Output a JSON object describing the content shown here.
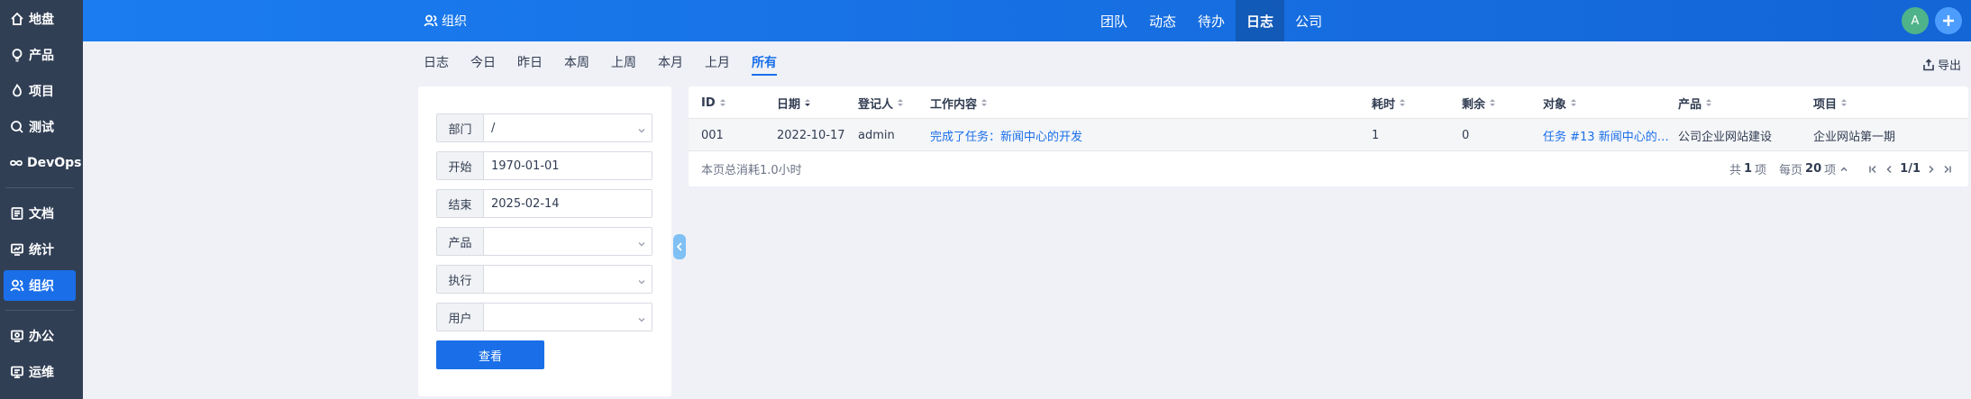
{
  "sidebar": {
    "items": [
      {
        "label": "地盘",
        "icon": "home-icon"
      },
      {
        "label": "产品",
        "icon": "lightbulb-icon"
      },
      {
        "label": "项目",
        "icon": "flame-icon"
      },
      {
        "label": "测试",
        "icon": "search-icon"
      },
      {
        "label": "DevOps",
        "icon": "infinity-icon"
      },
      {
        "label": "文档",
        "icon": "document-icon"
      },
      {
        "label": "统计",
        "icon": "chart-icon"
      },
      {
        "label": "组织",
        "icon": "users-icon"
      },
      {
        "label": "办公",
        "icon": "office-icon"
      },
      {
        "label": "运维",
        "icon": "ops-icon"
      }
    ],
    "active_index": 7
  },
  "topbar": {
    "title": "组织",
    "nav": [
      "团队",
      "动态",
      "待办",
      "日志",
      "公司"
    ],
    "active_nav": "日志",
    "avatar": "A"
  },
  "subtabs": {
    "items": [
      "日志",
      "今日",
      "昨日",
      "本周",
      "上周",
      "本月",
      "上月",
      "所有"
    ],
    "active": "所有",
    "export_label": "导出"
  },
  "filter": {
    "rows": [
      {
        "label": "部门",
        "value": "/",
        "dropdown": true
      },
      {
        "label": "开始",
        "value": "1970-01-01",
        "dropdown": false
      },
      {
        "label": "结束",
        "value": "2025-02-14",
        "dropdown": false
      },
      {
        "label": "产品",
        "value": "",
        "dropdown": true
      },
      {
        "label": "执行",
        "value": "",
        "dropdown": true
      },
      {
        "label": "用户",
        "value": "",
        "dropdown": true
      }
    ],
    "submit_label": "查看"
  },
  "table": {
    "columns": [
      "ID",
      "日期",
      "登记人",
      "工作内容",
      "耗时",
      "剩余",
      "对象",
      "产品",
      "项目"
    ],
    "sorted_column": "日期",
    "rows": [
      {
        "id": "001",
        "date": "2022-10-17",
        "user": "admin",
        "content": "完成了任务：新闻中心的开发",
        "consumed": "1",
        "left": "0",
        "object": "任务 #13 新闻中心的…",
        "product": "公司企业网站建设",
        "project": "企业网站第一期"
      }
    ],
    "footer_summary": "本页总消耗1.0小时",
    "pager": {
      "total_prefix": "共",
      "total": "1",
      "total_suffix": "项",
      "per_prefix": "每页",
      "per_page": "20",
      "per_suffix": "项",
      "page": "1/1"
    }
  },
  "colors": {
    "accent": "#1a6fe9",
    "sidebar_bg": "#313f55",
    "topbar_bg": "#1a7cf0"
  }
}
